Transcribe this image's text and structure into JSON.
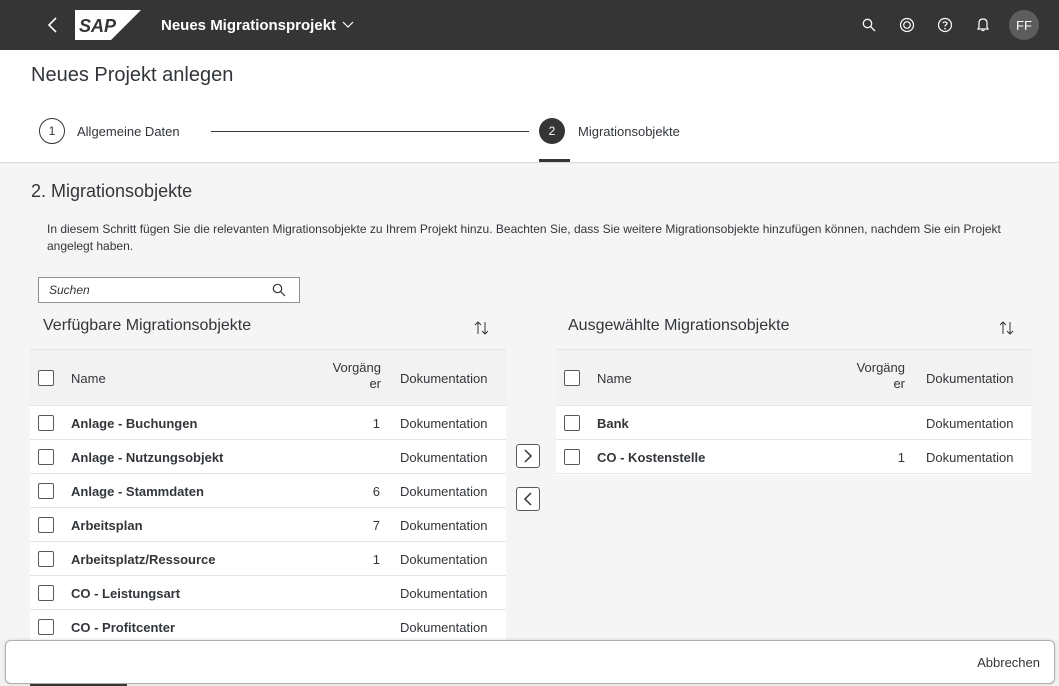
{
  "shell": {
    "logo_text": "SAP",
    "app_title": "Neues Migrationsprojekt",
    "avatar_initials": "FF",
    "icons": [
      "back-icon",
      "search-icon",
      "copilot-icon",
      "help-icon",
      "notification-icon"
    ]
  },
  "header": {
    "page_title": "Neues Projekt anlegen",
    "steps": [
      {
        "number": "1",
        "label": "Allgemeine Daten",
        "active": false
      },
      {
        "number": "2",
        "label": "Migrationsobjekte",
        "active": true
      }
    ]
  },
  "content": {
    "section_title": "2. Migrationsobjekte",
    "info_text": "In diesem Schritt fügen Sie die relevanten Migrationsobjekte zu Ihrem Projekt hinzu. Beachten Sie, dass Sie weitere Migrationsobjekte hinzufügen können, nachdem Sie ein Projekt angelegt haben.",
    "search_placeholder": "Suchen"
  },
  "available": {
    "title": "Verfügbare Migrationsobjekte",
    "columns": {
      "name": "Name",
      "count_line1": "Vorgäng",
      "count_line2": "er",
      "doc": "Dokumentation"
    },
    "rows": [
      {
        "name": "Anlage - Buchungen",
        "count": "1",
        "doc": "Dokumentation"
      },
      {
        "name": "Anlage - Nutzungsobjekt",
        "count": "",
        "doc": "Dokumentation"
      },
      {
        "name": "Anlage - Stammdaten",
        "count": "6",
        "doc": "Dokumentation"
      },
      {
        "name": "Arbeitsplan",
        "count": "7",
        "doc": "Dokumentation"
      },
      {
        "name": "Arbeitsplatz/Ressource",
        "count": "1",
        "doc": "Dokumentation"
      },
      {
        "name": "CO - Leistungsart",
        "count": "",
        "doc": "Dokumentation"
      },
      {
        "name": "CO - Profitcenter",
        "count": "",
        "doc": "Dokumentation"
      }
    ]
  },
  "selected": {
    "title": "Ausgewählte Migrationsobjekte",
    "columns": {
      "name": "Name",
      "count_line1": "Vorgäng",
      "count_line2": "er",
      "doc": "Dokumentation"
    },
    "rows": [
      {
        "name": "Bank",
        "count": "",
        "doc": "Dokumentation"
      },
      {
        "name": "CO - Kostenstelle",
        "count": "1",
        "doc": "Dokumentation"
      }
    ]
  },
  "move_buttons": {
    "add": ">",
    "remove": "<"
  },
  "footer": {
    "cancel_label": "Abbrechen"
  },
  "colors": {
    "shell": "#353535",
    "text": "#32363a",
    "background": "#f5f5f5"
  }
}
